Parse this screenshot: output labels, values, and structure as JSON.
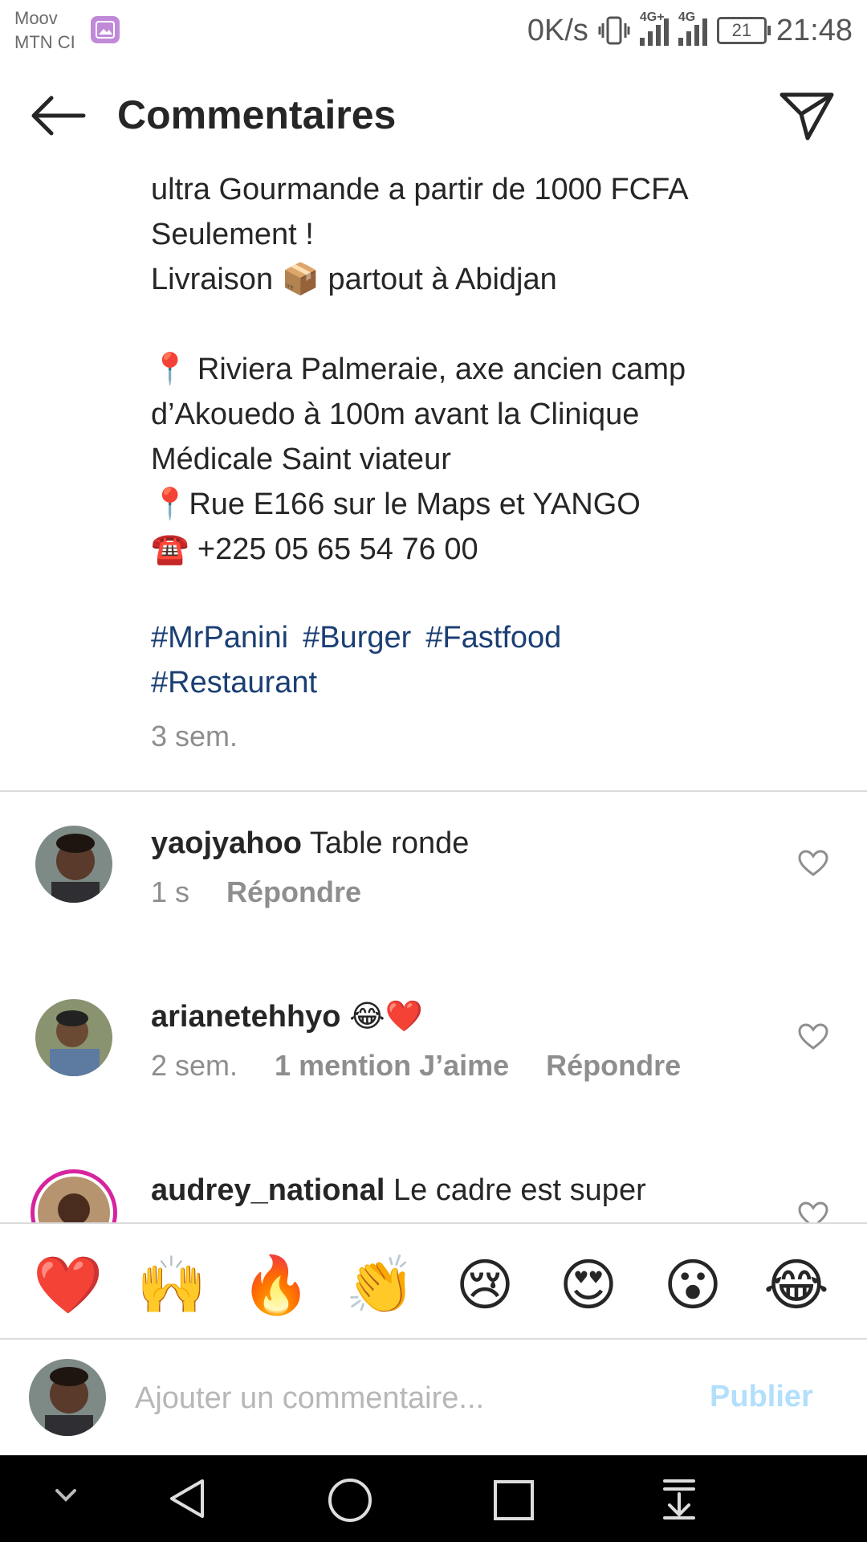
{
  "status_bar": {
    "carrier_line1": "Moov",
    "carrier_line2": "MTN CI",
    "speed": "0K/s",
    "net1": "4G+",
    "net2": "4G",
    "battery": "21",
    "time": "21:48"
  },
  "header": {
    "title": "Commentaires"
  },
  "caption": {
    "lines": [
      "ultra Gourmande a partir de 1000 FCFA",
      "Seulement !",
      "Livraison 📦 partout à Abidjan",
      "📍 Riviera Palmeraie, axe ancien camp",
      "d’Akouedo à 100m avant la Clinique",
      "Médicale Saint viateur",
      "📍Rue E166 sur le Maps et YANGO",
      "☎️ +225 05 65 54 76 00"
    ],
    "hashtags": [
      "#MrPanini",
      "#Burger",
      "#Fastfood",
      "#Restaurant"
    ],
    "time": "3 sem."
  },
  "comments": [
    {
      "username": "yaojyahoo",
      "text": "Table ronde",
      "time": "1 s",
      "likes": "",
      "reply": "Répondre"
    },
    {
      "username": "arianetehhyo",
      "text": "😂❤️",
      "time": "2 sem.",
      "likes": "1 mention J’aime",
      "reply": "Répondre"
    },
    {
      "username": "audrey_national",
      "text": "Le cadre est super",
      "time": "",
      "likes": "",
      "reply": ""
    }
  ],
  "emoji_bar": [
    "❤️",
    "🙌",
    "🔥",
    "👏",
    "😢",
    "😍",
    "😮",
    "😂"
  ],
  "composer": {
    "placeholder": "Ajouter un commentaire...",
    "publish": "Publier"
  },
  "colors": {
    "hashtag": "#1b3f74",
    "publish": "#b2dffc",
    "muted": "#8e8e8e",
    "story_ring": "#d6249f"
  }
}
